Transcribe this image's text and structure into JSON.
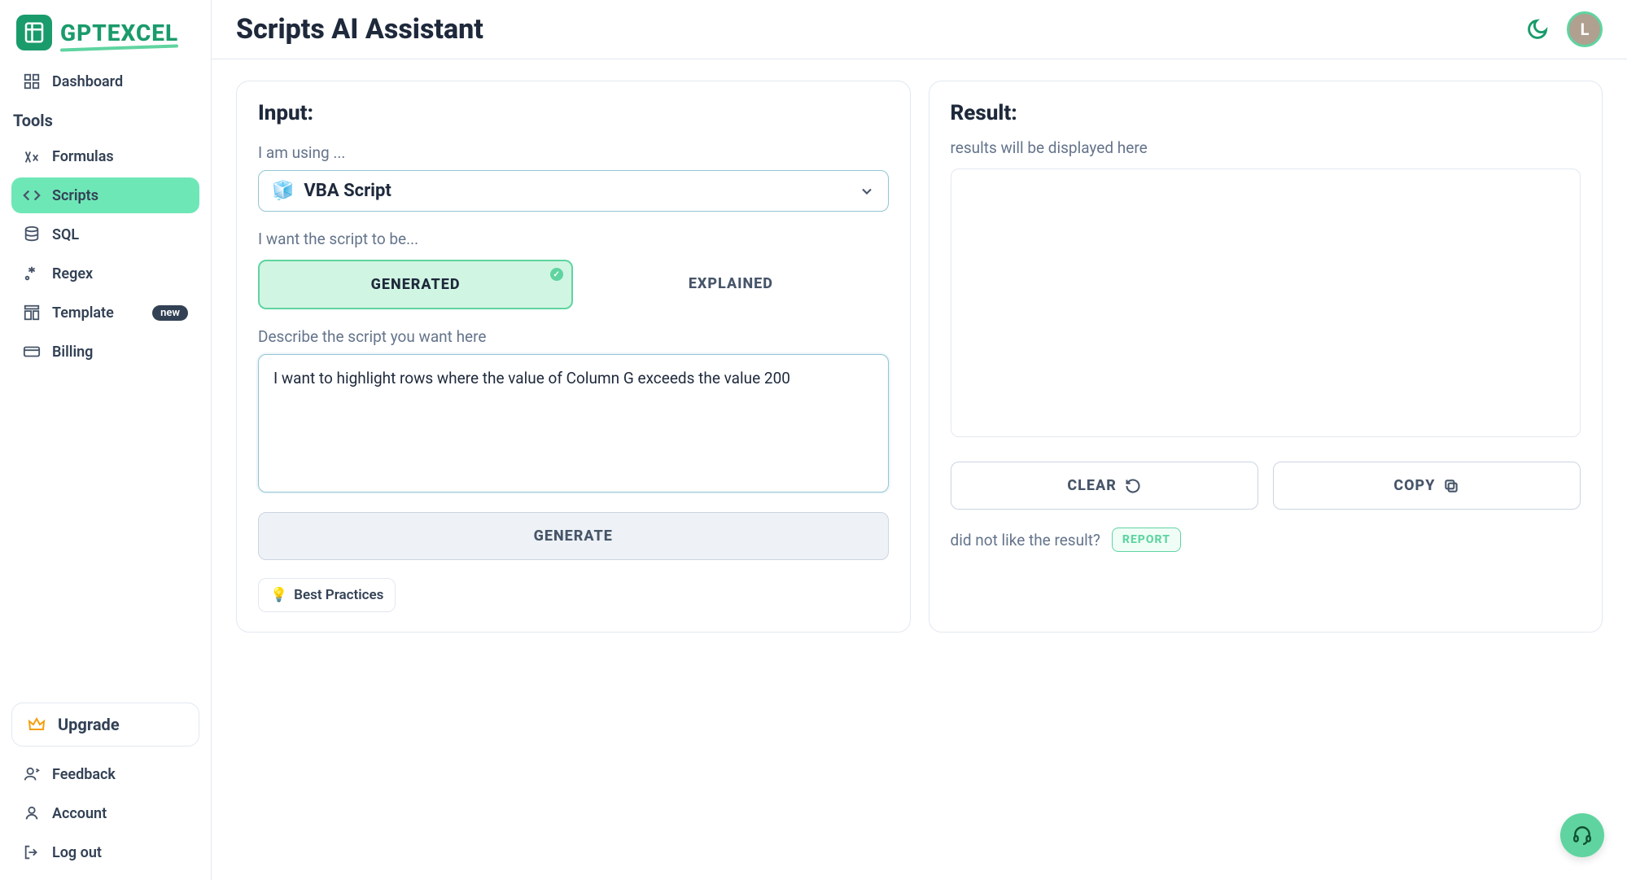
{
  "app": {
    "name": "GPTEXCEL",
    "page_title": "Scripts AI Assistant",
    "avatar_initial": "L"
  },
  "sidebar": {
    "top_item": "Dashboard",
    "tools_label": "Tools",
    "items": [
      {
        "label": "Formulas"
      },
      {
        "label": "Scripts"
      },
      {
        "label": "SQL"
      },
      {
        "label": "Regex"
      },
      {
        "label": "Template",
        "badge": "new"
      },
      {
        "label": "Billing"
      }
    ],
    "upgrade_label": "Upgrade",
    "bottom": [
      {
        "label": "Feedback"
      },
      {
        "label": "Account"
      },
      {
        "label": "Log out"
      }
    ]
  },
  "input_card": {
    "title": "Input:",
    "using_label": "I am using ...",
    "select_value": "VBA Script",
    "want_label": "I want the script to be...",
    "toggle_generated": "GENERATED",
    "toggle_explained": "EXPLAINED",
    "describe_label": "Describe the script you want here",
    "textarea_value": "I want to highlight rows where the value of Column G exceeds the value 200",
    "generate_label": "GENERATE",
    "best_practices_label": "Best Practices"
  },
  "result_card": {
    "title": "Result:",
    "placeholder": "results will be displayed here",
    "clear_label": "CLEAR",
    "copy_label": "COPY",
    "report_question": "did not like the result?",
    "report_label": "REPORT"
  }
}
